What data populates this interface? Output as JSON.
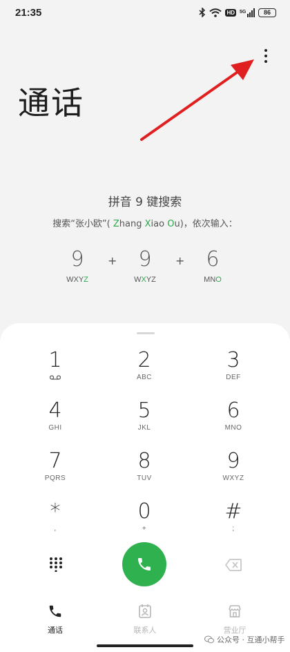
{
  "status_bar": {
    "time": "21:35",
    "hd": "HD",
    "network": "5G",
    "battery": "86"
  },
  "header": {
    "title": "通话"
  },
  "pinyin_hint": {
    "title": "拼音 9 键搜索",
    "line_prefix": "搜索“张小欧”( ",
    "line_parts": [
      {
        "text": "Z",
        "highlight": true
      },
      {
        "text": "hang ",
        "highlight": false
      },
      {
        "text": "X",
        "highlight": true
      },
      {
        "text": "iao ",
        "highlight": false
      },
      {
        "text": "O",
        "highlight": true
      },
      {
        "text": "u",
        "highlight": false
      }
    ],
    "line_suffix": ")，依次输入：",
    "example_keys": [
      {
        "num": "9",
        "letters_plain": "WXY",
        "letters_green": "Z",
        "letters_after": ""
      },
      {
        "num": "9",
        "letters_plain": "W",
        "letters_green": "X",
        "letters_after": "YZ"
      },
      {
        "num": "6",
        "letters_plain": "MN",
        "letters_green": "O",
        "letters_after": ""
      }
    ],
    "plus": "+"
  },
  "dialpad": {
    "keys": [
      {
        "num": "1",
        "sub": ""
      },
      {
        "num": "2",
        "sub": "ABC"
      },
      {
        "num": "3",
        "sub": "DEF"
      },
      {
        "num": "4",
        "sub": "GHI"
      },
      {
        "num": "5",
        "sub": "JKL"
      },
      {
        "num": "6",
        "sub": "MNO"
      },
      {
        "num": "7",
        "sub": "PQRS"
      },
      {
        "num": "8",
        "sub": "TUV"
      },
      {
        "num": "9",
        "sub": "WXYZ"
      },
      {
        "num": "*",
        "sub": ","
      },
      {
        "num": "0",
        "sub": "+"
      },
      {
        "num": "#",
        "sub": ";"
      }
    ]
  },
  "colors": {
    "accent_green": "#2fb14f",
    "arrow_red": "#e02020"
  },
  "tabs": [
    {
      "label": "通话",
      "icon": "phone-icon",
      "active": true
    },
    {
      "label": "联系人",
      "icon": "contacts-icon",
      "active": false
    },
    {
      "label": "营业厅",
      "icon": "store-icon",
      "active": false
    }
  ],
  "watermark": "公众号 · 互通小帮手"
}
